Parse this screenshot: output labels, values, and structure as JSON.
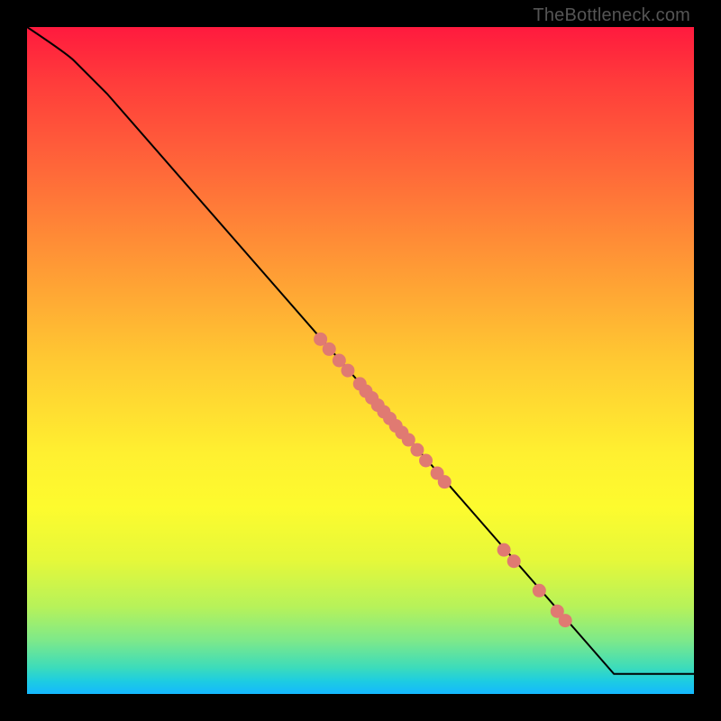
{
  "watermark": "TheBottleneck.com",
  "chart_data": {
    "type": "line",
    "title": "",
    "xlabel": "",
    "ylabel": "",
    "xlim": [
      0,
      100
    ],
    "ylim": [
      0,
      100
    ],
    "curve": [
      {
        "x": 0,
        "y": 100
      },
      {
        "x": 6,
        "y": 96
      },
      {
        "x": 12,
        "y": 90
      },
      {
        "x": 88,
        "y": 3
      },
      {
        "x": 100,
        "y": 3
      }
    ],
    "series": [
      {
        "name": "points",
        "color": "#e07a72",
        "points": [
          {
            "x": 44.0,
            "y": 53.2
          },
          {
            "x": 45.3,
            "y": 51.7
          },
          {
            "x": 46.8,
            "y": 50.0
          },
          {
            "x": 48.1,
            "y": 48.5
          },
          {
            "x": 49.9,
            "y": 46.5
          },
          {
            "x": 50.8,
            "y": 45.4
          },
          {
            "x": 51.7,
            "y": 44.4
          },
          {
            "x": 52.6,
            "y": 43.3
          },
          {
            "x": 53.5,
            "y": 42.3
          },
          {
            "x": 54.4,
            "y": 41.3
          },
          {
            "x": 55.3,
            "y": 40.2
          },
          {
            "x": 56.2,
            "y": 39.2
          },
          {
            "x": 57.2,
            "y": 38.1
          },
          {
            "x": 58.5,
            "y": 36.6
          },
          {
            "x": 59.8,
            "y": 35.0
          },
          {
            "x": 61.5,
            "y": 33.1
          },
          {
            "x": 62.6,
            "y": 31.8
          },
          {
            "x": 71.5,
            "y": 21.6
          },
          {
            "x": 73.0,
            "y": 19.9
          },
          {
            "x": 76.8,
            "y": 15.5
          },
          {
            "x": 79.5,
            "y": 12.4
          },
          {
            "x": 80.7,
            "y": 11.0
          }
        ]
      }
    ]
  }
}
